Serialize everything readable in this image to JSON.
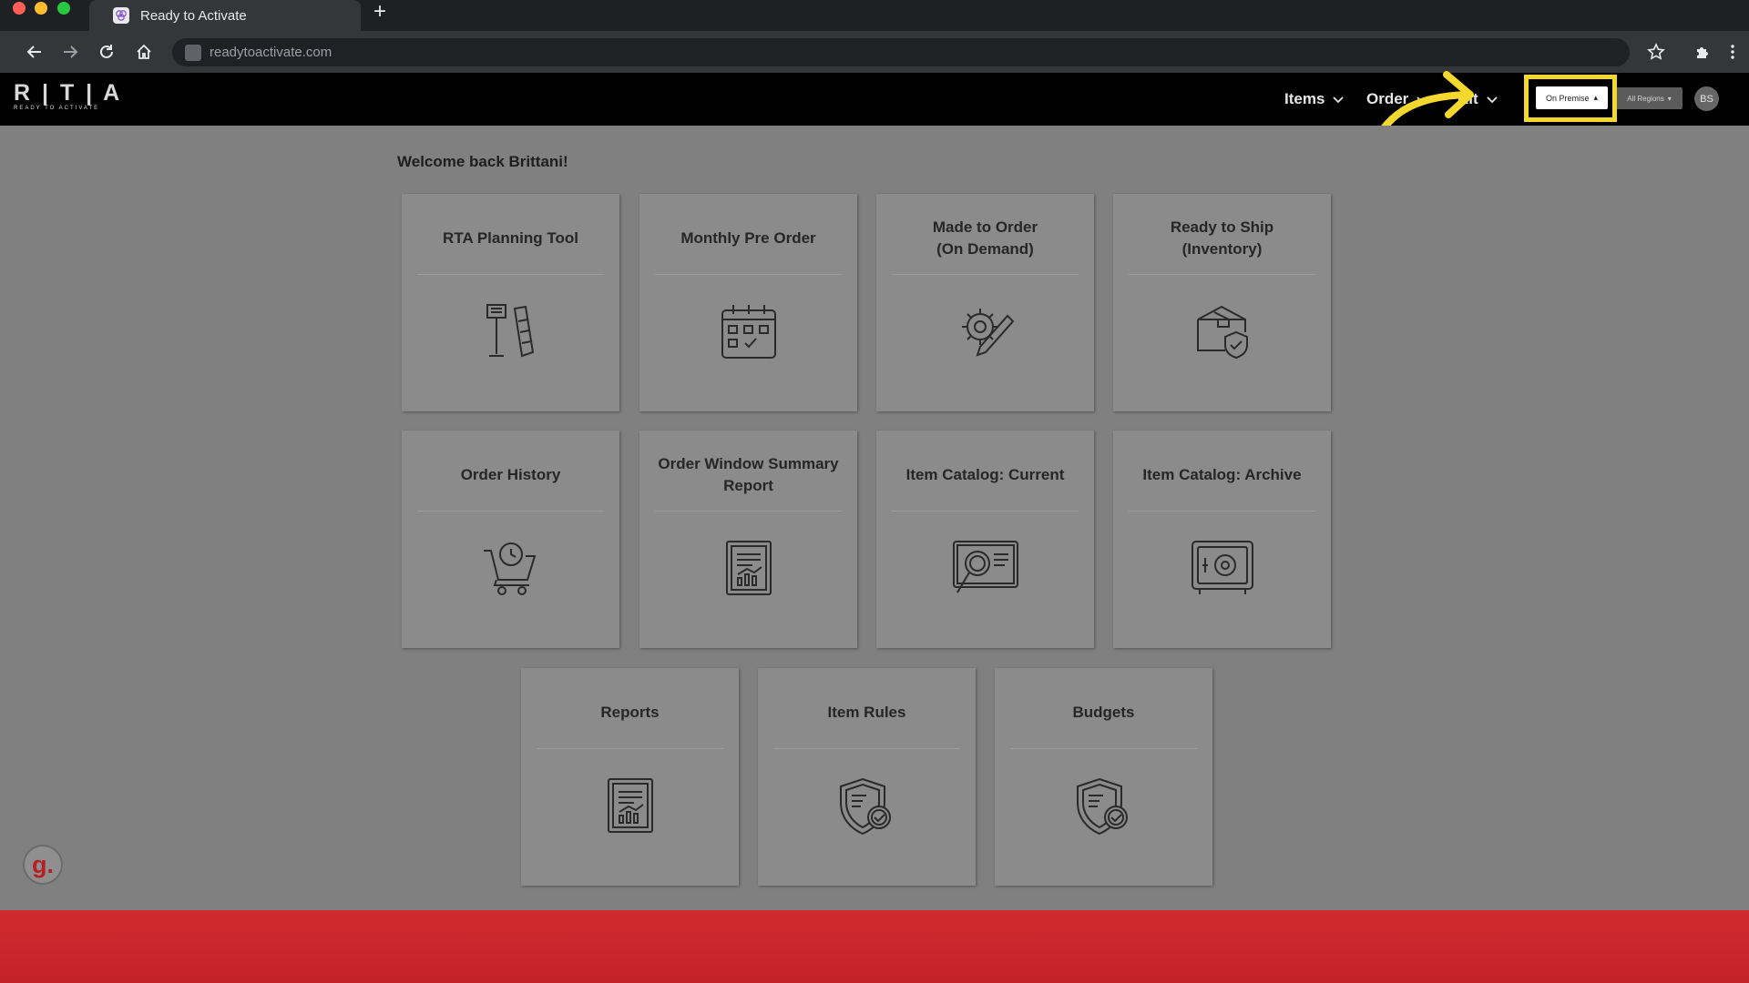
{
  "browser": {
    "tab_title": "Ready to Activate",
    "new_tab": "+",
    "url": "readytoactivate.com"
  },
  "app": {
    "logo_letters": "R | T | A",
    "logo_tagline": "READY TO ACTIVATE",
    "nav": {
      "items": "Items",
      "order": "Order",
      "kit": "Kit",
      "channel_select": "On Premise",
      "region_select": "All Regions",
      "user_initials": "BS"
    },
    "welcome": "Welcome back Brittani!"
  },
  "cards": [
    {
      "title": "RTA Planning Tool",
      "icon": "planning-tool-icon"
    },
    {
      "title": "Monthly Pre Order",
      "icon": "calendar-icon"
    },
    {
      "title": "Made to Order\n(On Demand)",
      "icon": "gear-pencil-icon"
    },
    {
      "title": "Ready to Ship\n(Inventory)",
      "icon": "box-shield-icon"
    },
    {
      "title": "Order History",
      "icon": "cart-clock-icon"
    },
    {
      "title": "Order Window Summary Report",
      "icon": "report-icon"
    },
    {
      "title": "Item Catalog: Current",
      "icon": "magnifier-monitor-icon"
    },
    {
      "title": "Item Catalog: Archive",
      "icon": "safe-icon"
    },
    {
      "title": "Reports",
      "icon": "report-icon"
    },
    {
      "title": "Item Rules",
      "icon": "shield-check-icon"
    },
    {
      "title": "Budgets",
      "icon": "shield-check-icon"
    }
  ],
  "helper_badge": "g.",
  "colors": {
    "highlight": "#f5d82e",
    "footer_red": "#d22a2e",
    "content_bg": "#808080"
  }
}
